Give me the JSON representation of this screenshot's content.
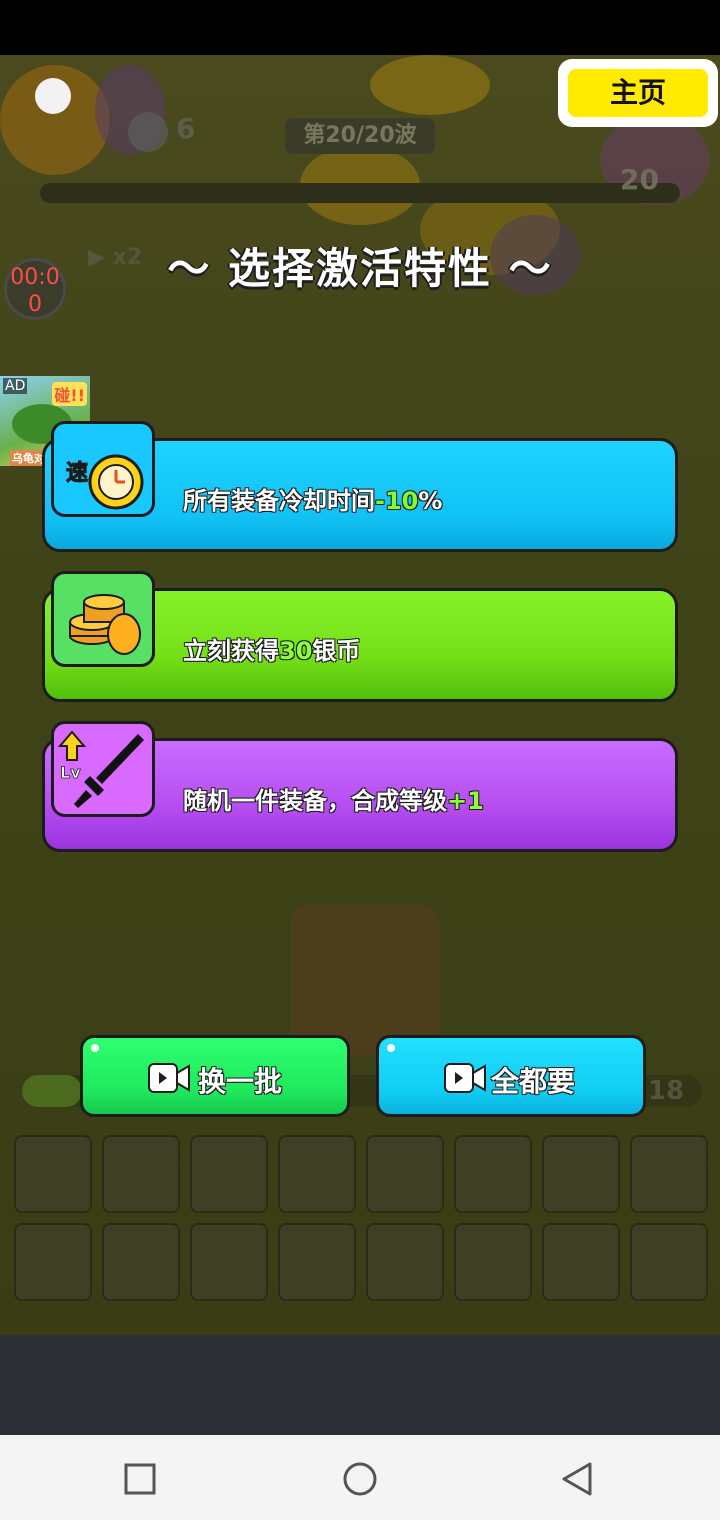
{
  "hud": {
    "coins": "6",
    "wave": "第20/20波",
    "wave_num": "20",
    "speed": "▶ x2",
    "timer": "00:0\n0",
    "xp": "18"
  },
  "home_button": {
    "label": "主页"
  },
  "ad": {
    "label": "AD",
    "caption_1": "碰!!",
    "caption_2": "乌龟对对碰"
  },
  "title": "〜 选择激活特性 〜",
  "cards": [
    {
      "icon": "clock-icon",
      "prefix": "所有装备冷却时间",
      "highlight": "-10",
      "suffix": "%"
    },
    {
      "icon": "coin-stack-icon",
      "prefix": "立刻获得",
      "highlight": "30",
      "suffix": "银币"
    },
    {
      "icon": "level-up-sword-icon",
      "prefix": "随机一件装备，合成等级",
      "highlight": "+1",
      "suffix": ""
    }
  ],
  "buttons": {
    "refresh": "换一批",
    "take_all": "全都要"
  },
  "colors": {
    "card_blue": "#10c2f5",
    "card_green": "#76e017",
    "card_purple": "#b64ef2",
    "home_yellow": "#ffea00"
  }
}
